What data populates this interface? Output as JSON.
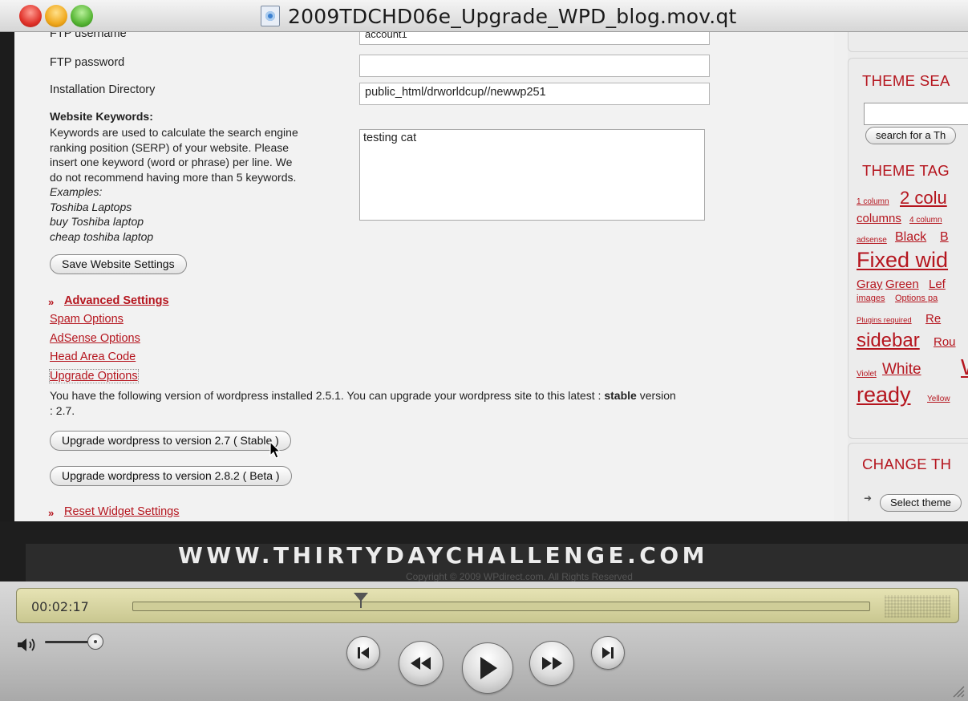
{
  "window": {
    "title": "2009TDCHD06e_Upgrade_WPD_blog.mov.qt"
  },
  "form": {
    "ftp_username_label": "FTP username",
    "ftp_username_value": "account1",
    "ftp_password_label": "FTP password",
    "ftp_password_value": "",
    "install_dir_label": "Installation Directory",
    "install_dir_value": "public_html/drworldcup//newwp251",
    "keywords_heading": "Website Keywords:",
    "keywords_help": [
      "Keywords are used to calculate the search engine",
      "ranking position (SERP) of your website. Please",
      "insert one keyword (word or phrase) per line. We",
      "do not recommend having more than 5 keywords."
    ],
    "examples_label": "Examples:",
    "examples": [
      "Toshiba Laptops",
      "buy Toshiba laptop",
      "cheap toshiba laptop"
    ],
    "keywords_value": "testing cat",
    "save_button": "Save Website Settings"
  },
  "advanced": {
    "bullet": "»",
    "heading": "Advanced Settings",
    "links": [
      "Spam Options",
      "AdSense Options",
      "Head Area Code",
      "Upgrade Options"
    ],
    "upgrade_text_1": "You have the following version of wordpress installed 2.5.1. You can upgrade your wordpress site to this latest : ",
    "upgrade_text_bold": "stable",
    "upgrade_text_2": " version",
    "upgrade_text_3": ": 2.7.",
    "upgrade_stable_button": "Upgrade wordpress to version 2.7 ( Stable )",
    "upgrade_beta_button": "Upgrade wordpress to version 2.8.2 ( Beta )",
    "reset_bullet": "»",
    "reset_link": "Reset Widget Settings"
  },
  "sidebar": {
    "theme_search_heading": "THEME SEA",
    "search_button": "search for a Th",
    "theme_tags_heading": "THEME TAG",
    "tags": [
      {
        "text": "1 column",
        "size": "s"
      },
      {
        "text": "2 colu",
        "size": "l"
      },
      {
        "text": "columns",
        "size": "m"
      },
      {
        "text": "4 column",
        "size": "s"
      },
      {
        "text": "adsense",
        "size": "s"
      },
      {
        "text": "Black",
        "size": "m"
      },
      {
        "text": "B",
        "size": "m"
      },
      {
        "text": "Fixed wid",
        "size": "xl"
      },
      {
        "text": "Gray",
        "size": "m"
      },
      {
        "text": "Green",
        "size": "m"
      },
      {
        "text": "Lef",
        "size": "m"
      },
      {
        "text": "images",
        "size": "s"
      },
      {
        "text": "Options pa",
        "size": "s"
      },
      {
        "text": "Plugins required",
        "size": "xs"
      },
      {
        "text": "Re",
        "size": "m"
      },
      {
        "text": "sidebar",
        "size": "xl"
      },
      {
        "text": "Rou",
        "size": "m"
      },
      {
        "text": "Violet",
        "size": "xs"
      },
      {
        "text": "White",
        "size": "l"
      },
      {
        "text": "W",
        "size": "xl"
      },
      {
        "text": "ready",
        "size": "xl"
      },
      {
        "text": "Yellow",
        "size": "s"
      }
    ],
    "change_theme_heading": "CHANGE TH",
    "select_theme": "Select theme"
  },
  "overlay": {
    "watermark": "WWW.THIRTYDAYCHALLENGE.COM",
    "copyright": "Copyright © 2009 WPdirect.com. All Rights Reserved"
  },
  "player": {
    "timecode": "00:02:17",
    "progress": 0.31,
    "volume": 0.9
  }
}
